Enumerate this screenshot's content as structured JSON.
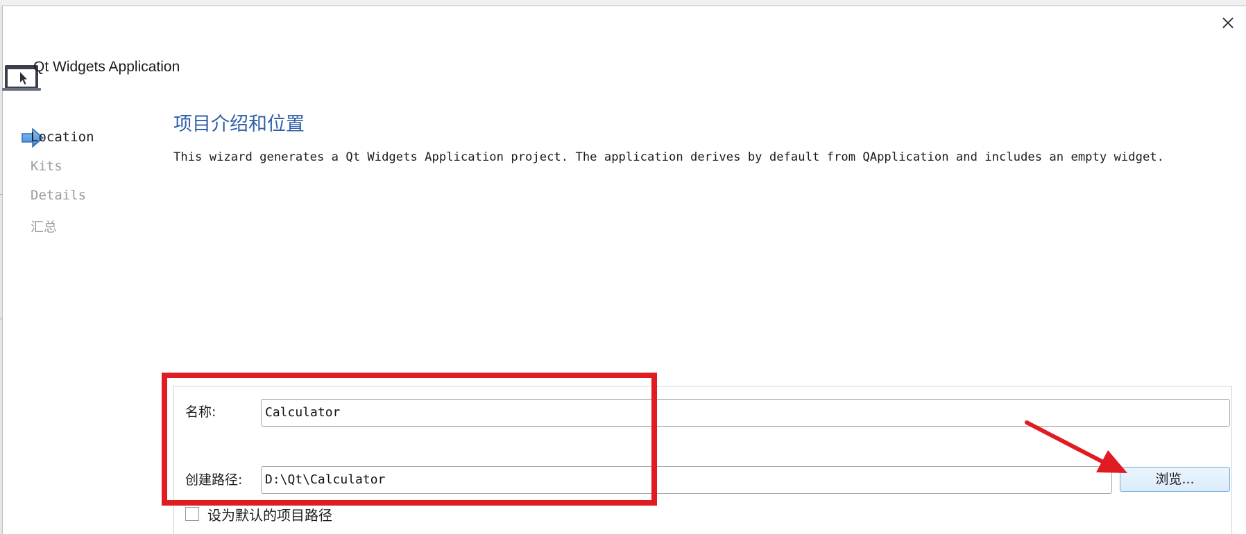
{
  "dialog": {
    "title": "Qt Widgets Application",
    "close_icon": "close-icon",
    "header_icon": "application-window-cursor-icon"
  },
  "steps": [
    {
      "label": "Location",
      "active": true
    },
    {
      "label": "Kits",
      "active": false
    },
    {
      "label": "Details",
      "active": false
    },
    {
      "label": "汇总",
      "active": false
    }
  ],
  "page": {
    "heading": "项目介绍和位置",
    "description": "This wizard generates a Qt Widgets Application project. The application derives by default from QApplication and includes an empty widget."
  },
  "form": {
    "name_label": "名称:",
    "name_value": "Calculator",
    "path_label": "创建路径:",
    "path_value": "D:\\Qt\\Calculator",
    "browse_label": "浏览...",
    "default_path_label": "设为默认的项目路径",
    "default_path_checked": false
  },
  "colors": {
    "heading": "#2e5fa8",
    "annotation": "#e11b22",
    "browse_border": "#6da9e0"
  }
}
